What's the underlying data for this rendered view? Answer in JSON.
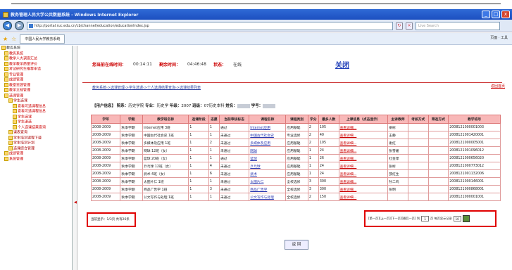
{
  "window": {
    "title": "教务管理人民大学公共数据系统 - Windows Internet Explorer",
    "min": "_",
    "max": "□",
    "close": "x"
  },
  "addressbar": {
    "url": "http://portal.ruc.edu.cn/cb/channel/education/educationIndex.jsp",
    "search_placeholder": "Live Search"
  },
  "tabbar": {
    "tab": "中国人民大学教务系统",
    "tools": "页面 · 工具"
  },
  "sidebar": {
    "items": [
      {
        "label": "教务系统",
        "lvl": "lvl0"
      },
      {
        "label": "教务系统",
        "lvl": "lvl1"
      },
      {
        "label": "教学人大调查汇总",
        "lvl": "lvl1"
      },
      {
        "label": "教学教学质量评价",
        "lvl": "lvl1"
      },
      {
        "label": "考试研究生推荐申请",
        "lvl": "lvl1"
      },
      {
        "label": "专业管理",
        "lvl": "lvl1"
      },
      {
        "label": "成绩管理",
        "lvl": "lvl1"
      },
      {
        "label": "教室资源管理",
        "lvl": "lvl1"
      },
      {
        "label": "教学文档管理",
        "lvl": "lvl1"
      },
      {
        "label": "选课管理",
        "lvl": "lvl1"
      },
      {
        "label": "学生选课",
        "lvl": "lvl2"
      },
      {
        "label": "查看可选课程信息",
        "lvl": "lvl3"
      },
      {
        "label": "查看可选课程信息",
        "lvl": "lvl3"
      },
      {
        "label": "学生选课",
        "lvl": "lvl3"
      },
      {
        "label": "学生退选",
        "lvl": "lvl3"
      },
      {
        "label": "个人选课结果查询",
        "lvl": "lvl3"
      },
      {
        "label": "课表查询",
        "lvl": "lvl2"
      },
      {
        "label": "学生培训课程下载",
        "lvl": "lvl2"
      },
      {
        "label": "学生培训计划",
        "lvl": "lvl2"
      },
      {
        "label": "选课综合管理",
        "lvl": "lvl2"
      },
      {
        "label": "成绩管理",
        "lvl": "lvl1"
      },
      {
        "label": "系统管理",
        "lvl": "lvl1"
      }
    ]
  },
  "status": {
    "online_label": "您当前在线时间：",
    "online_value": "00:14:11",
    "remain_label": "剩余时间：",
    "remain_value": "04:46:48",
    "state_label": "状态：",
    "state_value": "在线",
    "close": "关闭"
  },
  "breadcrumb": "教务系统->选课管理->学生选课->个人选课结果查询->选课结果列表",
  "back_link": "返回首页",
  "userinfo": {
    "label": "【用户信息】",
    "college_label": "院系：",
    "college": "历史学院",
    "major_label": "专业：",
    "major": "历史学",
    "grade_label": "年级：",
    "grade": "2007",
    "class_label": "班级：",
    "class": "07历史本科",
    "name_label": "姓名：",
    "id_label": "学号："
  },
  "table": {
    "headers": [
      "学年",
      "学期",
      "教学班名称",
      "选课阶段",
      "志愿",
      "当前审核标志",
      "课程名称",
      "课程类别",
      "学分",
      "最多人数",
      "上课信息（点击显示）",
      "主讲教师",
      "考核方式",
      "筛选方式",
      "教学班号"
    ],
    "rows": [
      [
        "2008-2009",
        "秋季学期",
        "Internet应用 3班",
        "1",
        "1",
        "通过",
        "Internet应用",
        "应用基础",
        "2",
        "105",
        "查看详细...",
        "梁彬",
        "",
        "",
        "2008121000001003"
      ],
      [
        "2008-2009",
        "秋季学期",
        "中国古代社会史 1班",
        "1",
        "1",
        "未通过",
        "中国古代社会史",
        "专业选修",
        "2",
        "40",
        "查看详细...",
        "王静",
        "",
        "",
        "2008121001420001"
      ],
      [
        "2008-2009",
        "秋季学期",
        "多媒体及应用 1班",
        "1",
        "2",
        "未通过",
        "多媒体及应用",
        "应用基础",
        "2",
        "105",
        "查看详细...",
        "谢红",
        "",
        "",
        "2008121000005001"
      ],
      [
        "2008-2009",
        "秋季学期",
        "网球 12班（女）",
        "1",
        "1",
        "未通过",
        "网球",
        "应用基础",
        "1",
        "24",
        "查看详细...",
        "张雪媛",
        "",
        "",
        "2008121001096012"
      ],
      [
        "2008-2009",
        "秋季学期",
        "篮球 20班（女）",
        "1",
        "1",
        "通过",
        "篮球",
        "应用基础",
        "1",
        "26",
        "查看详细...",
        "杜金萍",
        "",
        "",
        "2008121000656020"
      ],
      [
        "2008-2009",
        "秋季学期",
        "乒乓球 12班（女）",
        "1",
        "4",
        "未通过",
        "乒乓球",
        "应用基础",
        "1",
        "24",
        "查看详细...",
        "张彬",
        "",
        "",
        "2008121000773012"
      ],
      [
        "2008-2009",
        "秋季学期",
        "武术 4班（女）",
        "1",
        "6",
        "未通过",
        "武术",
        "应用基础",
        "1",
        "24",
        "查看详细...",
        "邵红生",
        "",
        "",
        "2008121001132006"
      ],
      [
        "2008-2009",
        "秋季学期",
        "太图片仁 1班",
        "1",
        "1",
        "未通过",
        "太图片仁",
        "全校选修",
        "3",
        "300",
        "查看详细...",
        "孙二鸣",
        "",
        "",
        "2008121000146001"
      ],
      [
        "2008-2009",
        "秋季学期",
        "商品广告学 1班",
        "1",
        "3",
        "未通过",
        "商品广告学",
        "全校选修",
        "3",
        "300",
        "查看详细...",
        "张明",
        "",
        "",
        "2008121000868001"
      ],
      [
        "2008-2009",
        "秋季学期",
        "公文写作与处理 1班",
        "1",
        "1",
        "未通过",
        "公文写作与处理",
        "全校选修",
        "2",
        "150",
        "查看详细...",
        "",
        "",
        "",
        "2008121000001001"
      ]
    ]
  },
  "pager": {
    "left": "当前显示：1/3页 共有26条",
    "right_text": "[第一页][上一页][下一页][最后一页] 到",
    "page": "1",
    "right_text2": "页 每页显示记录",
    "per_page": "10"
  },
  "back_button": "返 回"
}
